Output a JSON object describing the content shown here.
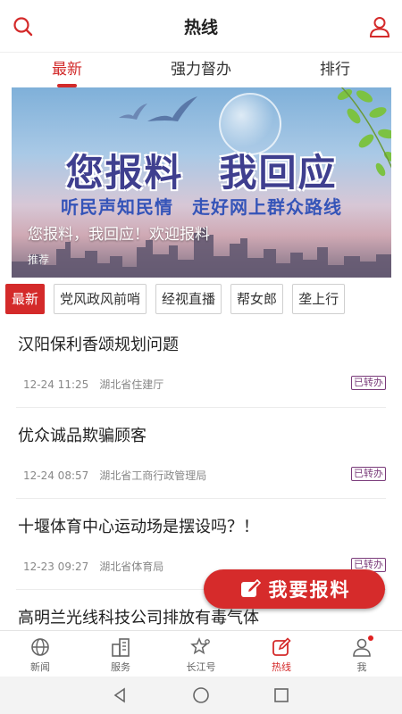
{
  "header": {
    "title": "热线",
    "search_icon": "search-icon",
    "user_icon": "user-icon"
  },
  "tabs": [
    {
      "label": "最新",
      "active": true
    },
    {
      "label": "强力督办",
      "active": false
    },
    {
      "label": "排行",
      "active": false
    }
  ],
  "banner": {
    "headline_left": "您报料",
    "headline_right": "我回应",
    "slogan": "听民声知民情　走好网上群众路线",
    "caption": "您报料，我回应！欢迎报料",
    "tag": "推荐"
  },
  "categories": [
    {
      "label": "最新",
      "active": true
    },
    {
      "label": "党风政风前哨",
      "active": false
    },
    {
      "label": "经视直播",
      "active": false
    },
    {
      "label": "帮女郎",
      "active": false
    },
    {
      "label": "垄上行",
      "active": false
    }
  ],
  "news": [
    {
      "title": "汉阳保利香颂规划问题",
      "time": "12-24 11:25",
      "dept": "湖北省住建厅",
      "status": "已转办"
    },
    {
      "title": "优众诚品欺骗顾客",
      "time": "12-24 08:57",
      "dept": "湖北省工商行政管理局",
      "status": "已转办"
    },
    {
      "title": "十堰体育中心运动场是摆设吗？！",
      "time": "12-23 09:27",
      "dept": "湖北省体育局",
      "status": "已转办"
    },
    {
      "title": "高明兰光线科技公司排放有毒气体",
      "time": "",
      "dept": "",
      "status": ""
    }
  ],
  "report_button": {
    "label": "我要报料",
    "icon": "edit-icon"
  },
  "bottom_nav": [
    {
      "label": "新闻",
      "icon": "globe-icon",
      "active": false
    },
    {
      "label": "服务",
      "icon": "buildings-icon",
      "active": false
    },
    {
      "label": "长江号",
      "icon": "star-icon",
      "active": false
    },
    {
      "label": "热线",
      "icon": "edit-icon",
      "active": true
    },
    {
      "label": "我",
      "icon": "user-icon",
      "active": false
    }
  ],
  "colors": {
    "accent": "#d42a2a",
    "status": "#7a3b7a"
  }
}
